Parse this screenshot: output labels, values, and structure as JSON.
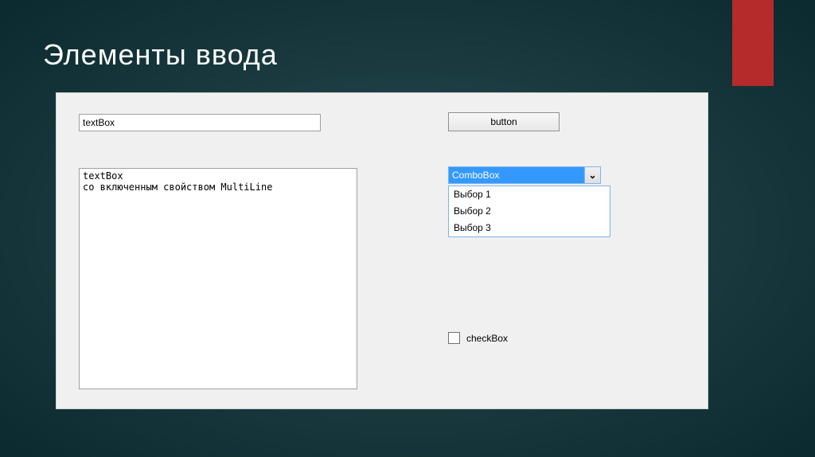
{
  "slide": {
    "title": "Элементы ввода"
  },
  "form": {
    "textbox_single": "textBox",
    "textbox_multi": "textBox\nсо включенным свойством MultiLine",
    "button_label": "button",
    "combobox": {
      "selected": "ComboBox",
      "options": [
        "Выбор 1",
        "Выбор 2",
        "Выбор 3"
      ]
    },
    "checkbox": {
      "label": "checkBox",
      "checked": false
    }
  }
}
